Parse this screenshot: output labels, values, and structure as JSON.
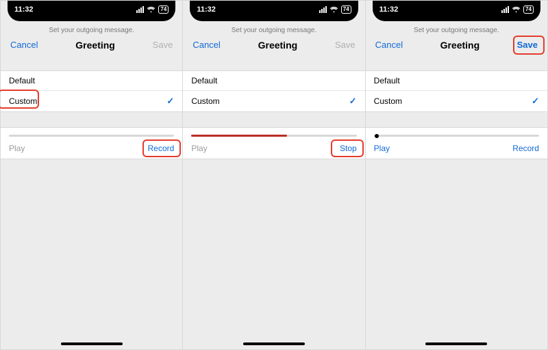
{
  "status": {
    "time": "11:32",
    "battery": "74"
  },
  "common": {
    "subtitle": "Set your outgoing message.",
    "cancel": "Cancel",
    "title": "Greeting",
    "option_default": "Default",
    "option_custom": "Custom",
    "play": "Play"
  },
  "screens": [
    {
      "save": "Save",
      "save_disabled": true,
      "action": "Record",
      "play_active": false,
      "progress_pct": 0,
      "show_dot": false,
      "highlight": "custom"
    },
    {
      "save": "Save",
      "save_disabled": true,
      "action": "Stop",
      "play_active": false,
      "progress_pct": 58,
      "show_dot": false,
      "highlight": "action"
    },
    {
      "save": "Save",
      "save_disabled": false,
      "action": "Record",
      "play_active": true,
      "progress_pct": 0,
      "show_dot": true,
      "highlight": "save"
    }
  ]
}
